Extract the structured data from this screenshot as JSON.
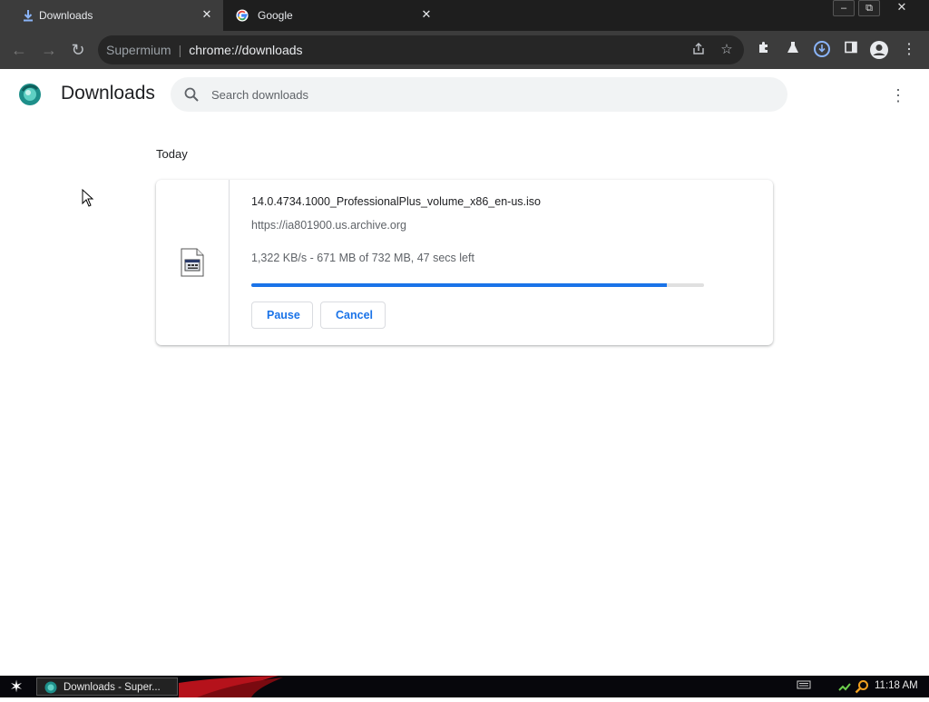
{
  "browser": {
    "tabs": [
      {
        "title": "Downloads",
        "active": true,
        "favicon": "download-icon"
      },
      {
        "title": "Google",
        "active": false,
        "favicon": "google-g-icon"
      }
    ],
    "window_controls": {
      "minimize": "–",
      "restore": "⧉",
      "close": "✕"
    },
    "omnibox": {
      "site_name": "Supermium",
      "separator": "|",
      "url": "chrome://downloads"
    },
    "accent": "#8ab4f8"
  },
  "downloads_page": {
    "title": "Downloads",
    "search_placeholder": "Search downloads",
    "section_date": "Today",
    "item": {
      "filename": "14.0.4734.1000_ProfessionalPlus_volume_x86_en-us.iso",
      "source_url": "https://ia801900.us.archive.org",
      "status": "1,322 KB/s - 671 MB of 732 MB, 47 secs left",
      "progress_fraction": 0.917,
      "pause_label": "Pause",
      "cancel_label": "Cancel"
    },
    "accent": "#1a73e8"
  },
  "taskbar": {
    "start_icon": "star-icon",
    "window_item": "Downloads - Super...",
    "clock": "11:18 AM"
  }
}
